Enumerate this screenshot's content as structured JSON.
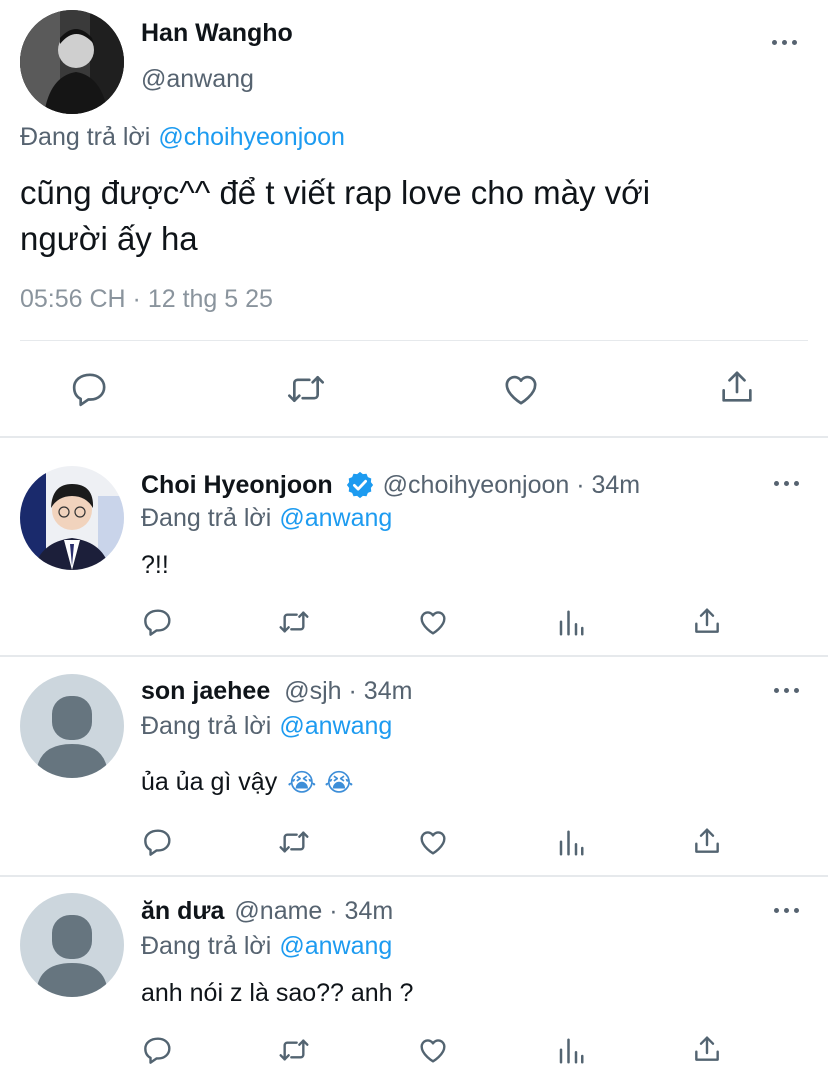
{
  "main_tweet": {
    "display_name": "Han Wangho",
    "handle": "@anwang",
    "reply_prefix": "Đang trả lời",
    "reply_to": "@choihyeonjoon",
    "text_line1": "cũng được^^ để t viết rap love cho mày với",
    "text_line2": "người ấy ha",
    "timestamp": "05:56 CH · 12 thg 5 25"
  },
  "replies": [
    {
      "display_name": "Choi Hyeonjoon",
      "verified": true,
      "handle_time": "@choihyeonjoon · 34m",
      "reply_prefix": "Đang trả lời",
      "reply_to": "@anwang",
      "text": "?!!"
    },
    {
      "display_name": "son jaehee",
      "verified": false,
      "handle_time": "@sjh · 34m",
      "reply_prefix": "Đang trả lời",
      "reply_to": "@anwang",
      "text": "ủa ủa gì vậy",
      "emoji": "😭 😭"
    },
    {
      "display_name": "ăn dưa",
      "verified": false,
      "handle_time": "@name · 34m",
      "reply_prefix": "Đang trả lời",
      "reply_to": "@anwang",
      "text": "anh nói z là sao?? anh ?"
    }
  ],
  "colors": {
    "link": "#1d9bf0",
    "text": "#0f1419",
    "muted": "#566370",
    "icon": "#536471",
    "divider": "#e6e9ec",
    "default_avatar_bg": "#ccd6dd",
    "default_avatar_fg": "#66757f"
  },
  "icons": [
    "reply-icon",
    "retweet-icon",
    "like-icon",
    "views-icon",
    "share-icon",
    "more-icon",
    "verified-badge-icon"
  ]
}
